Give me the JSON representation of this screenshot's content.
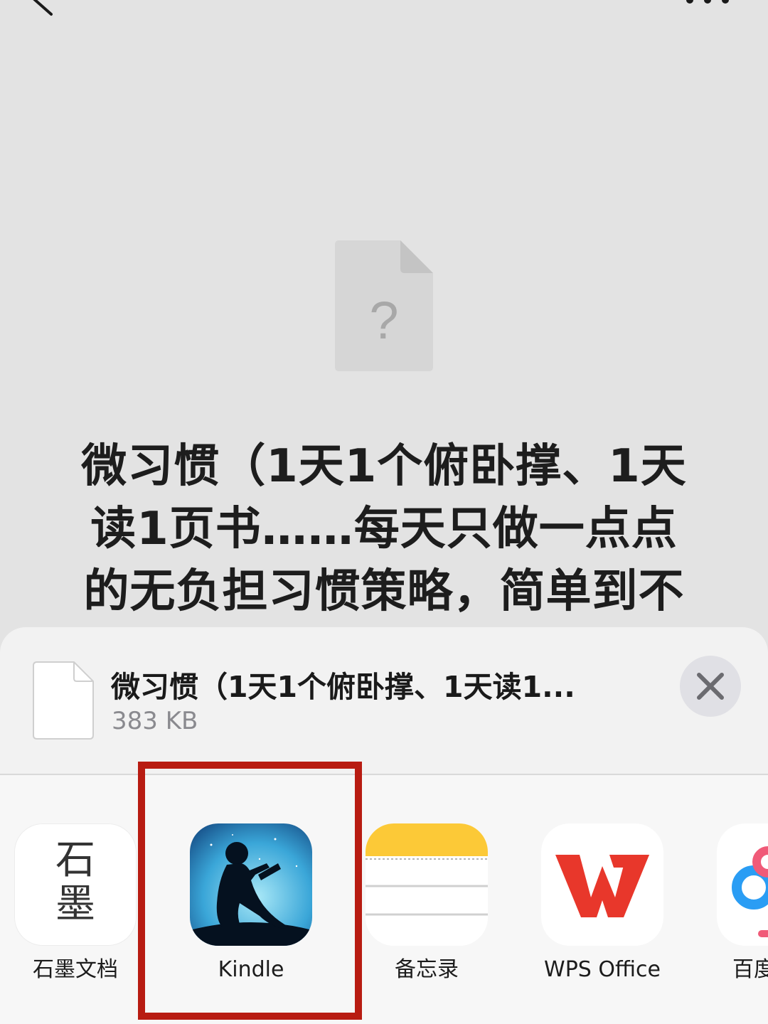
{
  "preview": {
    "title": "微习惯（1天1个俯卧撑、1天读1页书……每天只做一点点的无负担习惯策略，简单到不可",
    "placeholder_glyph": "?"
  },
  "sheet": {
    "file_name": "微习惯（1天1个俯卧撑、1天读1...",
    "file_size": "383 KB"
  },
  "apps": [
    {
      "label": "石墨文档",
      "icon_text_1": "石",
      "icon_text_2": "墨"
    },
    {
      "label": "Kindle"
    },
    {
      "label": "备忘录"
    },
    {
      "label": "WPS Office"
    },
    {
      "label": "百度"
    }
  ],
  "colors": {
    "highlight": "#b81c12",
    "wps_red": "#e8372b",
    "notes_yellow": "#fcc937"
  }
}
